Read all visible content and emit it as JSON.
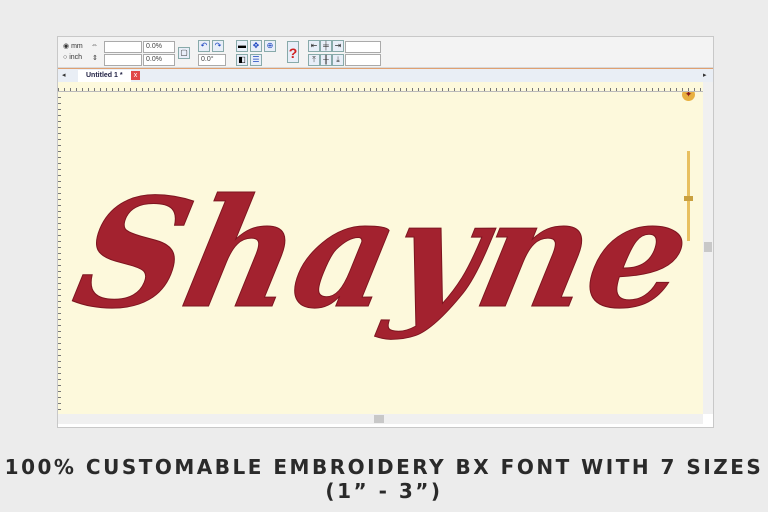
{
  "toolbar": {
    "unit_mm": "mm",
    "unit_inch": "inch",
    "width_pct": "0.0%",
    "height_pct": "0.0%",
    "rotation": "0.0°"
  },
  "tab": {
    "label": "Untitled 1 *",
    "close": "x"
  },
  "design": {
    "text": "Shayne",
    "color": "#a3222f"
  },
  "canvas": {
    "background": "#fdf9dc"
  },
  "caption": "100% CUSTOMABLE EMBROIDERY BX FONT WITH 7 SIZES (1” -  3”)"
}
